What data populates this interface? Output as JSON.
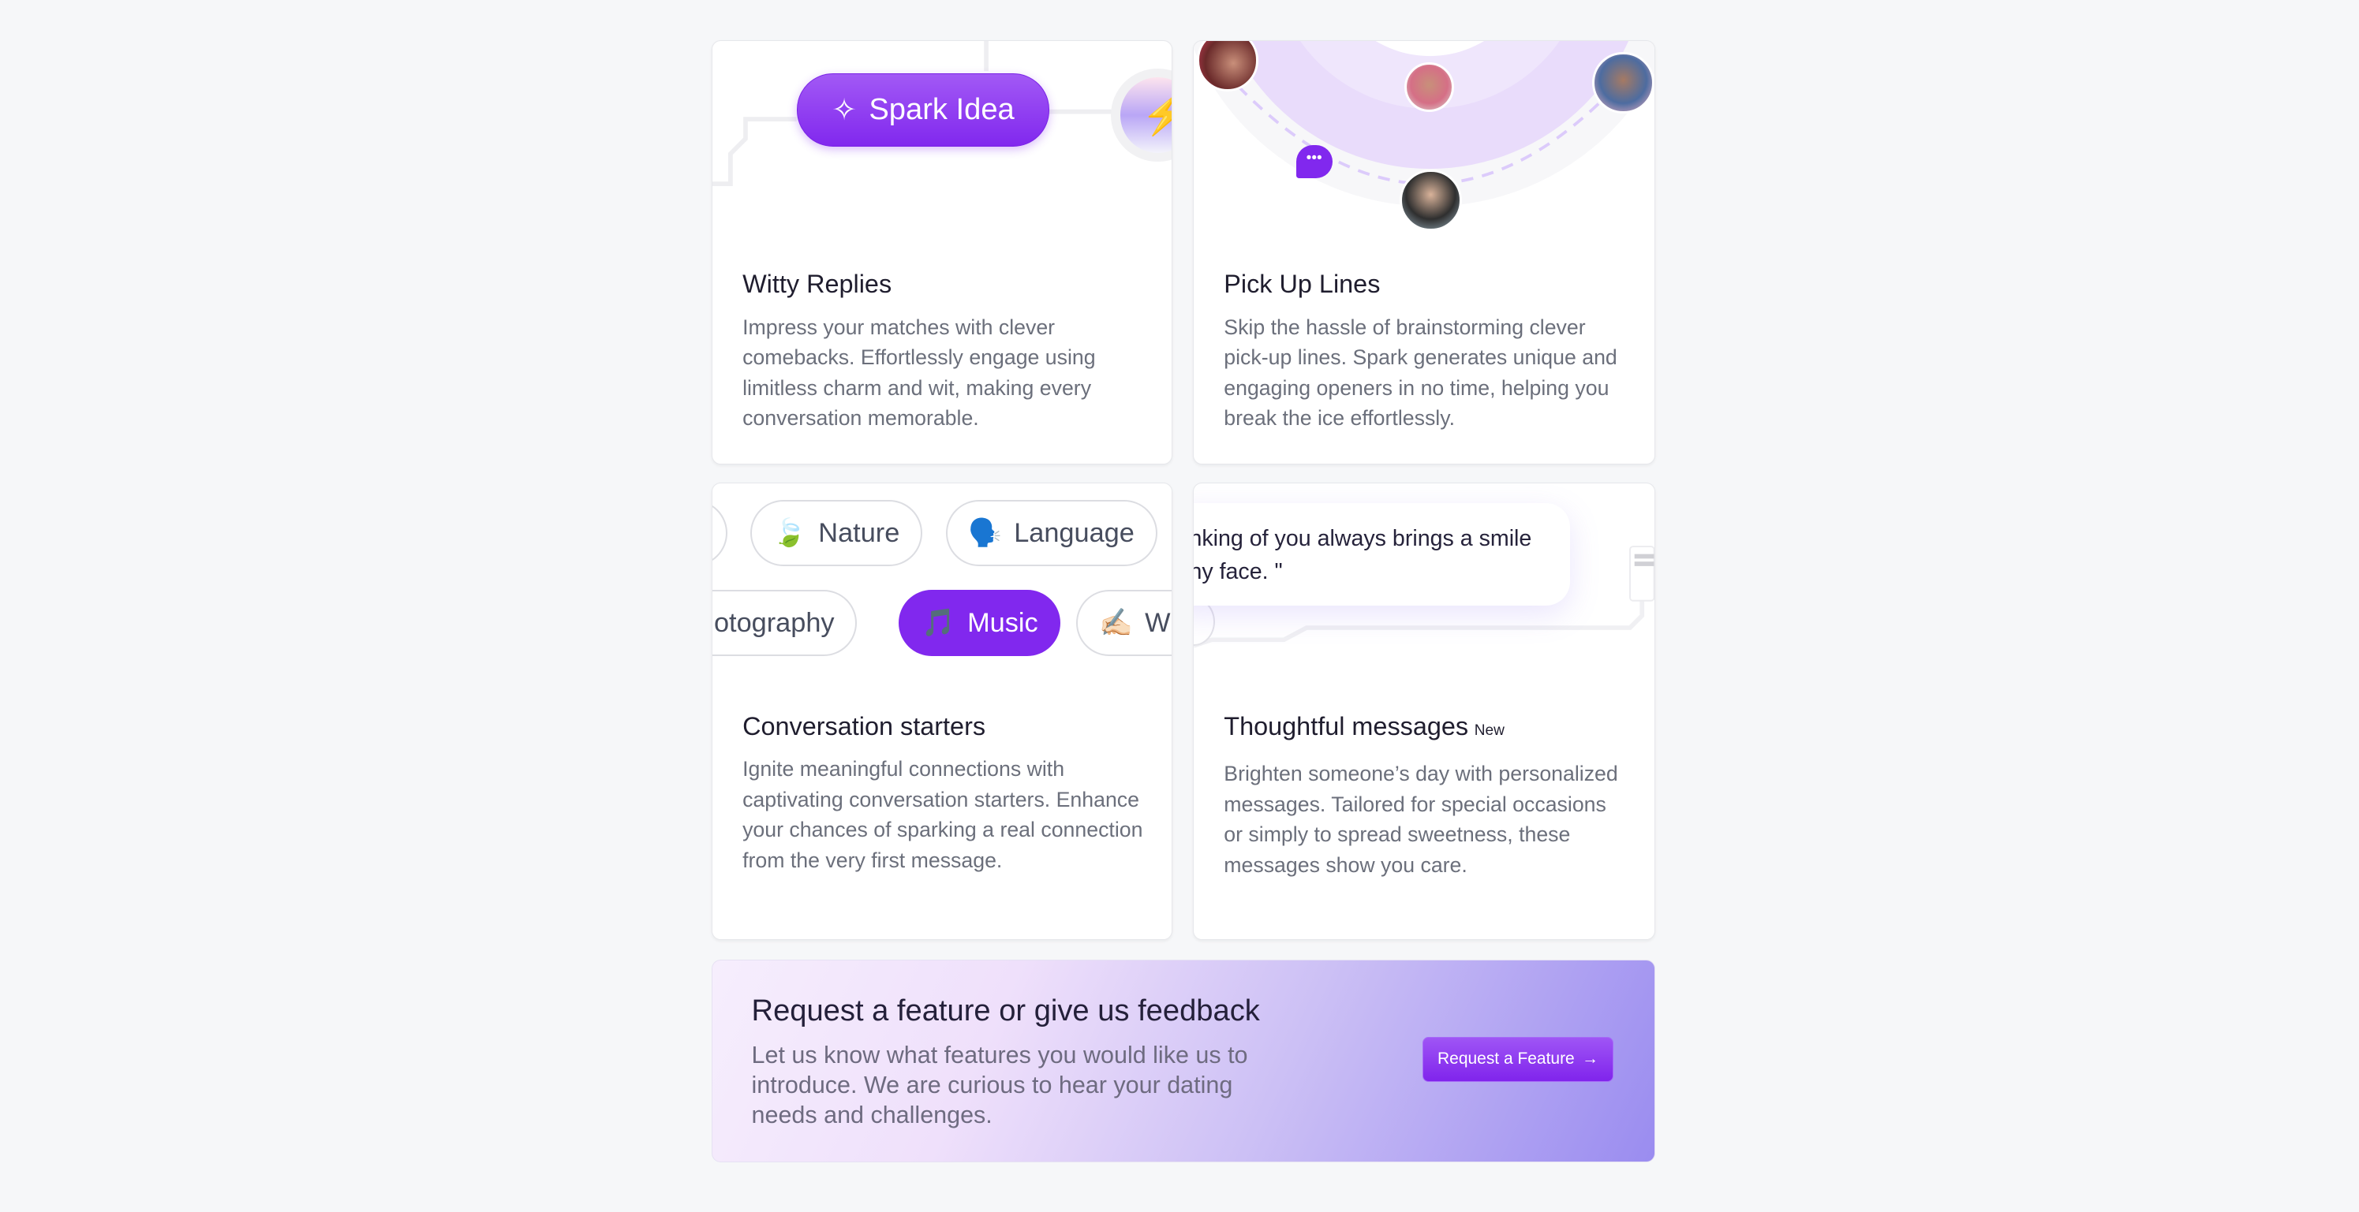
{
  "cards": [
    {
      "title": "Witty Replies",
      "description": "Impress your matches with clever comebacks. Effortlessly engage using limitless charm and wit, making every conversation memorable.",
      "button": "Spark Idea",
      "button_icon": "sparkles-icon",
      "side_icon": "lightning-icon"
    },
    {
      "title": "Pick Up Lines",
      "description": "Skip the hassle of brainstorming clever pick-up lines. Spark generates unique and engaging openers in no time, helping you break the ice effortlessly.",
      "chat_icon": "chat-bubble-icon"
    },
    {
      "title": "Conversation starters",
      "description": "Ignite meaningful connections with captivating conversation starters. Enhance your chances of sparking a real connection from the very first message.",
      "chips_row1": [
        {
          "emoji": "🍃",
          "label": "Nature"
        },
        {
          "emoji": "🗣️",
          "label": "Language"
        }
      ],
      "chips_row2": [
        {
          "label": "hotography"
        },
        {
          "emoji": "🎵",
          "label": "Music",
          "selected": true
        },
        {
          "emoji": "✍🏻",
          "label": "Wri"
        }
      ]
    },
    {
      "title": "Thoughtful messages",
      "badge": "New",
      "description": "Brighten someone’s day with personalized messages. Tailored for special occasions or simply to spread sweetness, these messages show you care.",
      "message_line1": "nking of you always brings a smile",
      "message_line2": "ny face. \""
    }
  ],
  "banner": {
    "title": "Request a feature or give us feedback",
    "description": "Let us know what features you would like us to introduce. We are curious to hear your dating needs and challenges.",
    "button": "Request a Feature",
    "button_arrow": "→"
  },
  "colors": {
    "accent": "#8128ee",
    "background": "#f6f7f9",
    "title": "#1f1d2e",
    "text": "#6b6f7b"
  }
}
